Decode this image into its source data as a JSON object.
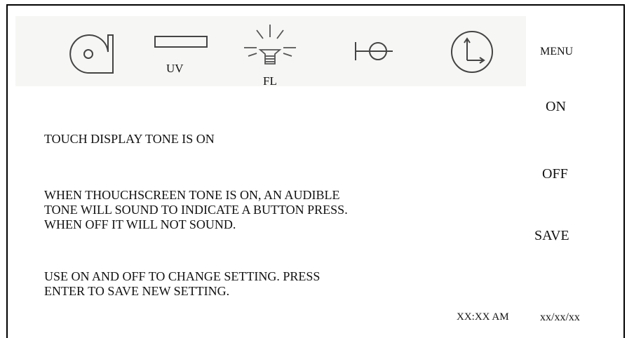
{
  "toolbar": {
    "icons": [
      {
        "name": "blower-fan-icon"
      },
      {
        "name": "uv-lamp-icon",
        "label": "UV"
      },
      {
        "name": "fluorescent-light-icon",
        "label": "FL"
      },
      {
        "name": "valve-icon"
      },
      {
        "name": "clock-icon"
      }
    ],
    "menu_label": "MENU"
  },
  "side_buttons": {
    "on": "ON",
    "off": "OFF",
    "save": "SAVE"
  },
  "content": {
    "status": "TOUCH DISPLAY TONE IS ON",
    "description": [
      "WHEN THOUCHSCREEN TONE IS ON, AN AUDIBLE",
      "TONE WILL SOUND TO INDICATE A BUTTON PRESS.",
      "WHEN OFF IT WILL NOT SOUND."
    ],
    "instructions": [
      "USE ON AND OFF TO CHANGE SETTING.  PRESS",
      "ENTER TO SAVE NEW SETTING."
    ]
  },
  "footer": {
    "time": "XX:XX AM",
    "date": "xx/xx/xx"
  }
}
